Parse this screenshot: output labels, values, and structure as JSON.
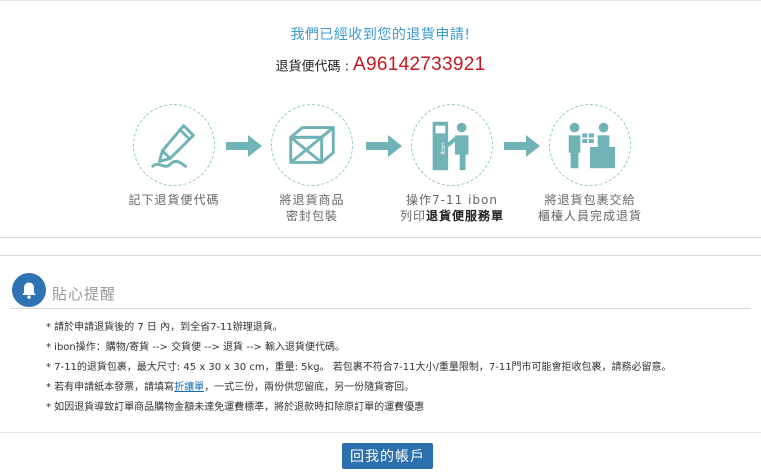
{
  "header": {
    "headline": "我們已經收到您的退貨申請!",
    "code_label": "退貨便代碼 :",
    "code_value": "A96142733921"
  },
  "steps": [
    {
      "icon": "pen-signature-icon",
      "lines": [
        "記下退貨便代碼"
      ]
    },
    {
      "icon": "package-box-icon",
      "lines": [
        "將退貨商品",
        "密封包裝"
      ]
    },
    {
      "icon": "ibon-kiosk-icon",
      "line1": "操作7-11 ibon",
      "line2_prefix": "列印",
      "line2_bold": "退貨便服務單"
    },
    {
      "icon": "counter-clerk-icon",
      "lines": [
        "將退貨包裹交給",
        "櫃檯人員完成退貨"
      ]
    }
  ],
  "tips": {
    "title": "貼心提醒",
    "items": [
      "* 請於申請退貨後的 7 日 內，到全省7-11辦理退貨。",
      "* ibon操作：購物/寄貨 --> 交貨便 --> 退貨 --> 輸入退貨便代碼。",
      "* 7-11的退貨包裹，最大尺寸: 45 x 30 x 30 cm，重量: 5kg。 若包裹不符合7-11大小/重量限制，7-11門市可能會拒收包裹，請務必留意。"
    ],
    "item4_prefix": "* 若有申請紙本發票，請填寫",
    "item4_link": "折讓單",
    "item4_suffix": "，一式三份，兩份供您留底，另一份隨貨寄回。",
    "item5": "* 如因退貨導致訂單商品購物金額未達免運費標準，將於退款時扣除原訂單的運費優惠"
  },
  "footer": {
    "back_label": "回我的帳戶"
  },
  "colors": {
    "headline": "#3a9bd4",
    "code": "#c7161d",
    "accent": "#6fb3b6",
    "button": "#2c6fae"
  }
}
